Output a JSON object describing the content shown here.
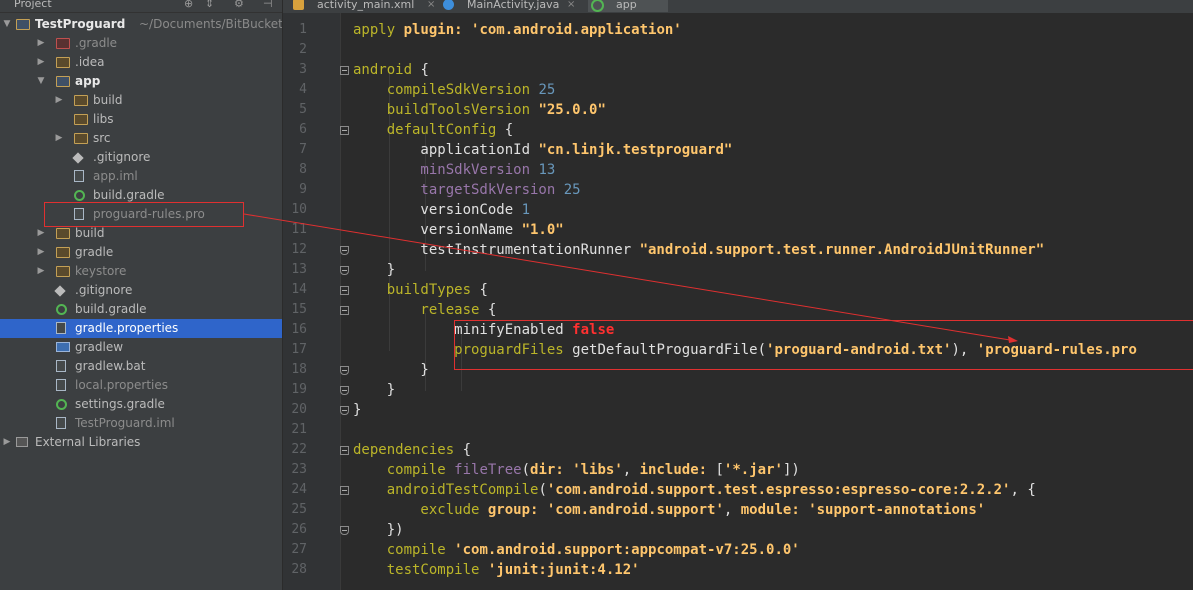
{
  "project_panel": {
    "title": "Project",
    "tree": [
      {
        "label": "TestProguard",
        "path": "~/Documents/BitBucket/Te",
        "bold": true
      },
      {
        "label": ".gradle"
      },
      {
        "label": ".idea"
      },
      {
        "label": "app",
        "bold": true
      },
      {
        "label": "build"
      },
      {
        "label": "libs"
      },
      {
        "label": "src"
      },
      {
        "label": ".gitignore"
      },
      {
        "label": "app.iml"
      },
      {
        "label": "build.gradle"
      },
      {
        "label": "proguard-rules.pro"
      },
      {
        "label": "build"
      },
      {
        "label": "gradle"
      },
      {
        "label": "keystore"
      },
      {
        "label": ".gitignore"
      },
      {
        "label": "build.gradle"
      },
      {
        "label": "gradle.properties",
        "selected": true
      },
      {
        "label": "gradlew"
      },
      {
        "label": "gradlew.bat"
      },
      {
        "label": "local.properties"
      },
      {
        "label": "settings.gradle"
      },
      {
        "label": "TestProguard.iml"
      },
      {
        "label": "External Libraries"
      }
    ]
  },
  "tabs": [
    {
      "label": "activity_main.xml"
    },
    {
      "label": "MainActivity.java"
    },
    {
      "label": "app",
      "active": true
    }
  ],
  "line_numbers": [
    "1",
    "2",
    "3",
    "4",
    "5",
    "6",
    "7",
    "8",
    "9",
    "10",
    "11",
    "12",
    "13",
    "14",
    "15",
    "16",
    "17",
    "18",
    "19",
    "20",
    "21",
    "22",
    "23",
    "24",
    "25",
    "26",
    "27",
    "28"
  ],
  "code": [
    [
      [
        "apply ",
        "vy"
      ],
      [
        "plugin: ",
        "strb"
      ],
      [
        "'com.android.application'",
        "strb"
      ]
    ],
    [],
    [
      [
        "android ",
        "vy"
      ],
      [
        "{",
        "wh"
      ]
    ],
    [
      [
        "    compileSdkVersion ",
        "vy"
      ],
      [
        "25",
        "num"
      ]
    ],
    [
      [
        "    buildToolsVersion ",
        "vy"
      ],
      [
        "\"25.0.0\"",
        "strb"
      ]
    ],
    [
      [
        "    defaultConfig ",
        "vy"
      ],
      [
        "{",
        "wh"
      ]
    ],
    [
      [
        "        applicationId ",
        "wh"
      ],
      [
        "\"cn.linjk.testproguard\"",
        "strb"
      ]
    ],
    [
      [
        "        minSdkVersion ",
        "id"
      ],
      [
        "13",
        "num"
      ]
    ],
    [
      [
        "        targetSdkVersion ",
        "id"
      ],
      [
        "25",
        "num"
      ]
    ],
    [
      [
        "        versionCode ",
        "wh"
      ],
      [
        "1",
        "num"
      ]
    ],
    [
      [
        "        versionName ",
        "wh"
      ],
      [
        "\"1.0\"",
        "strb"
      ]
    ],
    [
      [
        "        testInstrumentationRunner ",
        "wh"
      ],
      [
        "\"android.support.test.runner.AndroidJUnitRunner\"",
        "strb"
      ]
    ],
    [
      [
        "    }",
        "wh"
      ]
    ],
    [
      [
        "    buildTypes ",
        "vy"
      ],
      [
        "{",
        "wh"
      ]
    ],
    [
      [
        "        release ",
        "vy"
      ],
      [
        "{",
        "wh"
      ]
    ],
    [
      [
        "            minifyEnabled ",
        "wh"
      ],
      [
        "false",
        "red-false"
      ]
    ],
    [
      [
        "            proguardFiles ",
        "vy"
      ],
      [
        "getDefaultProguardFile(",
        "wh"
      ],
      [
        "'proguard-android.txt'",
        "strb"
      ],
      [
        "), ",
        "wh"
      ],
      [
        "'proguard-rules.pro",
        "strb"
      ]
    ],
    [
      [
        "        }",
        "wh"
      ]
    ],
    [
      [
        "    }",
        "wh"
      ]
    ],
    [
      [
        "}",
        "wh"
      ]
    ],
    [],
    [
      [
        "dependencies ",
        "vy"
      ],
      [
        "{",
        "wh"
      ]
    ],
    [
      [
        "    compile ",
        "vy"
      ],
      [
        "fileTree",
        "id"
      ],
      [
        "(",
        "wh"
      ],
      [
        "dir: ",
        "strb"
      ],
      [
        "'libs'",
        "strb"
      ],
      [
        ", ",
        "wh"
      ],
      [
        "include: ",
        "strb"
      ],
      [
        "[",
        "wh"
      ],
      [
        "'*.jar'",
        "strb"
      ],
      [
        "])",
        "wh"
      ]
    ],
    [
      [
        "    androidTestCompile",
        "vy"
      ],
      [
        "(",
        "wh"
      ],
      [
        "'com.android.support.test.espresso:espresso-core:2.2.2'",
        "strb"
      ],
      [
        ", {",
        "wh"
      ]
    ],
    [
      [
        "        exclude ",
        "vy"
      ],
      [
        "group: ",
        "strb"
      ],
      [
        "'com.android.support'",
        "strb"
      ],
      [
        ", ",
        "wh"
      ],
      [
        "module: ",
        "strb"
      ],
      [
        "'support-annotations'",
        "strb"
      ]
    ],
    [
      [
        "    })",
        "wh"
      ]
    ],
    [
      [
        "    compile ",
        "vy"
      ],
      [
        "'com.android.support:appcompat-v7:25.0.0'",
        "strb"
      ]
    ],
    [
      [
        "    testCompile ",
        "vy"
      ],
      [
        "'junit:junit:4.12'",
        "strb"
      ]
    ]
  ]
}
